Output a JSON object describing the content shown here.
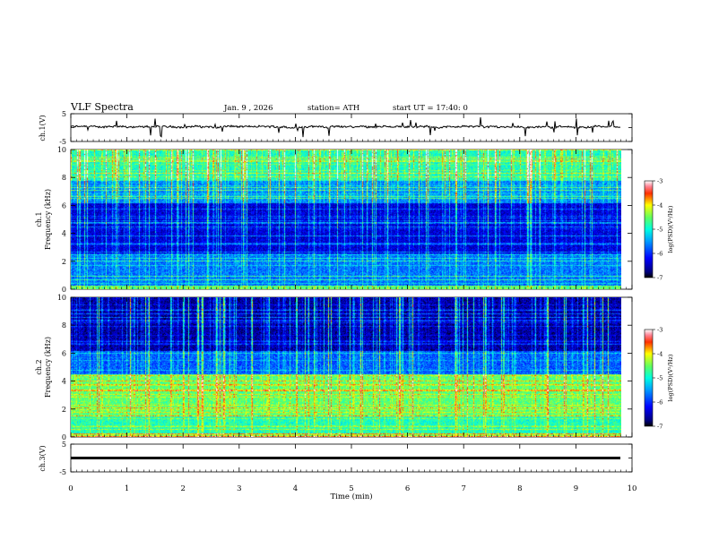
{
  "header": {
    "title": "VLF Spectra",
    "date": "Jan. 9 , 2026",
    "station": "station= ATH",
    "start": "start UT = 17:40: 0"
  },
  "chart_data": [
    {
      "type": "line",
      "name": "ch1-waveform",
      "ylabel": "ch.1(V)",
      "ylim": [
        -5,
        5
      ],
      "yticks": [
        "5",
        "-5"
      ],
      "x_range_min": [
        0,
        9.8
      ],
      "trace_level": 0.3
    },
    {
      "type": "heatmap",
      "name": "ch1-spectrogram",
      "ylabel": "ch.1\nFrequency (kHz)",
      "ylabel_channel": "ch.1",
      "ylabel_freq": "Frequency (kHz)",
      "ylim": [
        0,
        10
      ],
      "yticks": [
        "0",
        "2",
        "4",
        "6",
        "8",
        "10"
      ],
      "colorbar": {
        "label": "log(PSD)(V²/Hz)",
        "range": [
          -7,
          -3
        ],
        "ticks": [
          "-3",
          "-4",
          "-5",
          "-6",
          "-7"
        ]
      }
    },
    {
      "type": "heatmap",
      "name": "ch2-spectrogram",
      "ylabel": "ch.2\nFrequency (kHz)",
      "ylabel_channel": "ch.2",
      "ylabel_freq": "Frequency (kHz)",
      "ylim": [
        0,
        10
      ],
      "yticks": [
        "0",
        "2",
        "4",
        "6",
        "8",
        "10"
      ],
      "colorbar": {
        "label": "log(PSD)(V²/Hz)",
        "range": [
          -7,
          -3
        ],
        "ticks": [
          "-3",
          "-4",
          "-5",
          "-6",
          "-7"
        ]
      }
    },
    {
      "type": "line",
      "name": "ch3-waveform",
      "ylabel": "ch.3(V)",
      "ylim": [
        -5,
        5
      ],
      "yticks": [
        "5",
        "-5"
      ],
      "x_range_min": [
        0,
        9.8
      ],
      "trace_level": 0
    }
  ],
  "xaxis": {
    "label": "Time (min)",
    "range": [
      0,
      10
    ],
    "ticks": [
      "0",
      "1",
      "2",
      "3",
      "4",
      "5",
      "6",
      "7",
      "8",
      "9",
      "10"
    ]
  }
}
